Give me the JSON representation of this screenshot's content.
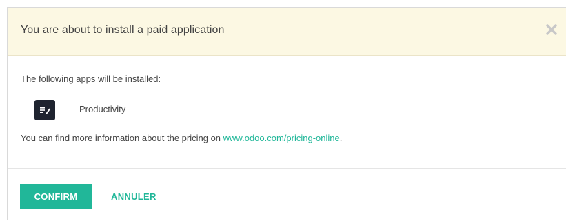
{
  "dialog": {
    "title": "You are about to install a paid application",
    "close_icon": "close-icon",
    "intro_text": "The following apps will be installed:",
    "apps": [
      {
        "name": "Productivity",
        "icon": "productivity-icon"
      }
    ],
    "pricing_text": "You can find more information about the pricing on ",
    "pricing_link": "www.odoo.com/pricing-online",
    "pricing_suffix": ".",
    "confirm_label": "CONFIRM",
    "cancel_label": "ANNULER"
  },
  "colors": {
    "header_bg": "#fcf8e3",
    "accent": "#21b799",
    "text": "#444444",
    "app_icon_bg": "#1f2430"
  }
}
